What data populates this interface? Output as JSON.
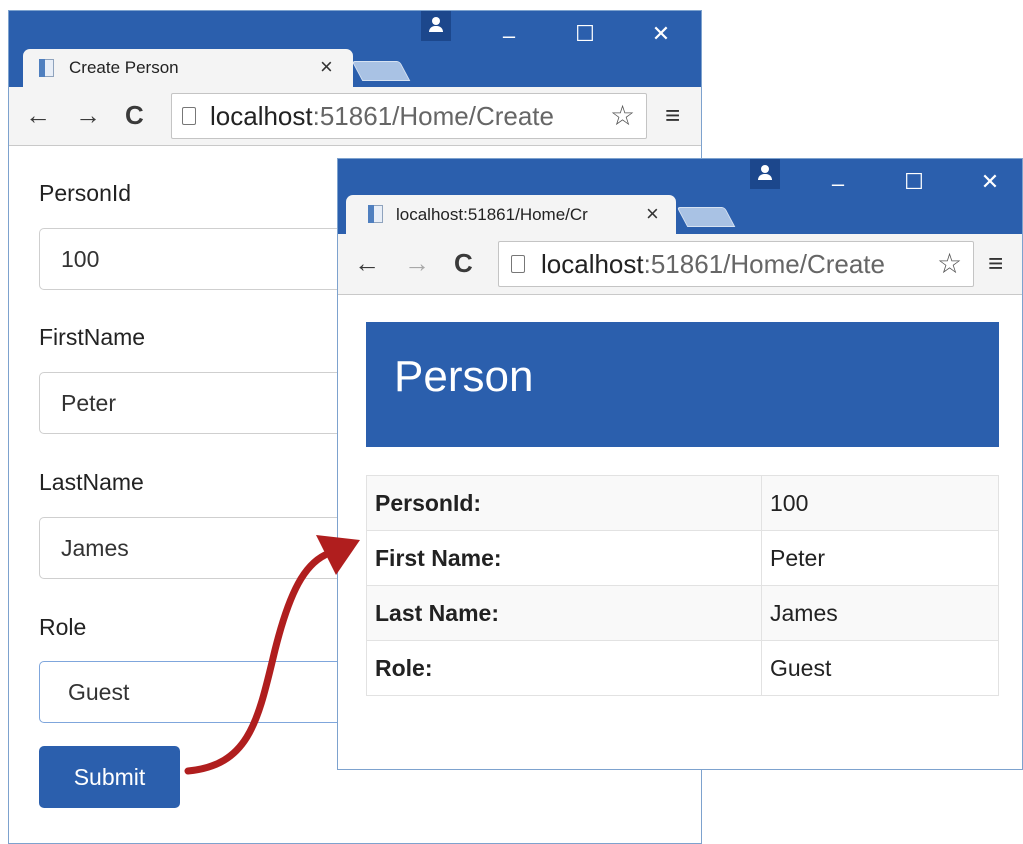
{
  "back_window": {
    "tab_title": "Create Person",
    "tab_close": "×",
    "url_host": "localhost",
    "url_path": ":51861/Home/Create",
    "controls": {
      "minimize": "–",
      "maximize": "☐",
      "close": "✕"
    },
    "nav": {
      "back": "←",
      "forward": "→",
      "reload": "C"
    },
    "star": "☆",
    "menu": "≡",
    "form": {
      "fields": [
        {
          "label": "PersonId",
          "value": "100"
        },
        {
          "label": "FirstName",
          "value": "Peter"
        },
        {
          "label": "LastName",
          "value": "James"
        },
        {
          "label": "Role",
          "value": "Guest"
        }
      ],
      "submit_label": "Submit"
    }
  },
  "front_window": {
    "tab_title": "localhost:51861/Home/Cr",
    "tab_close": "×",
    "url_host": "localhost",
    "url_path": ":51861/Home/Create",
    "controls": {
      "minimize": "–",
      "maximize": "☐",
      "close": "✕"
    },
    "nav": {
      "back": "←",
      "forward": "→",
      "reload": "C"
    },
    "star": "☆",
    "menu": "≡",
    "header": "Person",
    "table": [
      {
        "key": "PersonId:",
        "value": "100"
      },
      {
        "key": "First Name:",
        "value": "Peter"
      },
      {
        "key": "Last Name:",
        "value": "James"
      },
      {
        "key": "Role:",
        "value": "Guest"
      }
    ]
  },
  "colors": {
    "titlebar": "#2b5fad",
    "accent": "#2b5fad",
    "arrow": "#b01e1e"
  }
}
